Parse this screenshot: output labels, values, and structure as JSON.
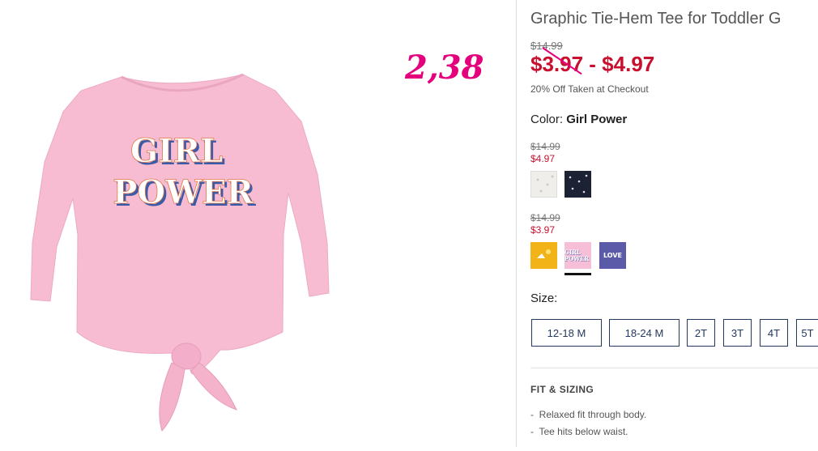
{
  "product": {
    "title": "Graphic Tie-Hem Tee for Toddler G",
    "old_price": "$14.99",
    "sale_price": "$3.97 - $4.97",
    "promo": "20% Off Taken at Checkout",
    "shirt_graphic_line1": "GIRL",
    "shirt_graphic_line2": "POWER"
  },
  "annotation": {
    "price_note": "2,38",
    "color": "#e4007c"
  },
  "color": {
    "label": "Color:",
    "selected": "Girl Power",
    "groups": [
      {
        "old_price": "$14.99",
        "new_price": "$4.97",
        "swatches": [
          {
            "name": "white-swatch",
            "color": "#f0eeea"
          },
          {
            "name": "navy-star-swatch",
            "color": "#1c2233"
          }
        ]
      },
      {
        "old_price": "$14.99",
        "new_price": "$3.97",
        "swatches": [
          {
            "name": "yellow-swatch",
            "color": "#f2b319"
          },
          {
            "name": "pink-girl-power-swatch",
            "color": "#f6bfd7",
            "text": "GIRL POWER",
            "selected": true
          },
          {
            "name": "purple-love-swatch",
            "color": "#5b5aa8",
            "text": "LOVE"
          }
        ]
      }
    ]
  },
  "size": {
    "label": "Size:",
    "options": [
      "12-18 M",
      "18-24 M",
      "2T",
      "3T",
      "4T",
      "5T"
    ]
  },
  "fit": {
    "title": "FIT & SIZING",
    "items": [
      "Relaxed fit through body.",
      "Tee hits below waist."
    ]
  },
  "colors": {
    "sale_red": "#c8102e",
    "navy": "#23395d",
    "shirt_pink": "#f7bcd2"
  }
}
